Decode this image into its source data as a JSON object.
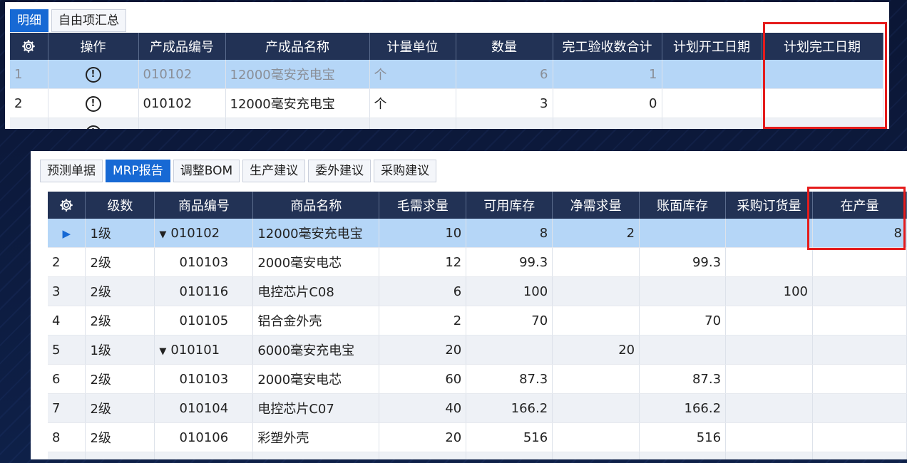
{
  "top_panel": {
    "tabs": [
      "明细",
      "自由项汇总"
    ],
    "headers": [
      "操作",
      "产成品编号",
      "产成品名称",
      "计量单位",
      "数量",
      "完工验收数合计",
      "计划开工日期",
      "计划完工日期"
    ],
    "rows": [
      {
        "idx": "1",
        "code": "010102",
        "name": "12000毫安充电宝",
        "unit": "个",
        "qty": "6",
        "done": "1",
        "start": "",
        "end": ""
      },
      {
        "idx": "2",
        "code": "010102",
        "name": "12000毫安充电宝",
        "unit": "个",
        "qty": "3",
        "done": "0",
        "start": "",
        "end": ""
      }
    ]
  },
  "bottom_panel": {
    "tabs": [
      "预测单据",
      "MRP报告",
      "调整BOM",
      "生产建议",
      "委外建议",
      "采购建议"
    ],
    "headers": [
      "级数",
      "商品编号",
      "商品名称",
      "毛需求量",
      "可用库存",
      "净需求量",
      "账面库存",
      "采购订货量",
      "在产量"
    ],
    "rows": [
      {
        "idx": "",
        "level": "1级",
        "code": "010102",
        "name": "12000毫安充电宝",
        "gross": "10",
        "avail": "8",
        "net": "2",
        "book": "",
        "purch": "",
        "wip": "8"
      },
      {
        "idx": "2",
        "level": "2级",
        "code": "010103",
        "name": "2000毫安电芯",
        "gross": "12",
        "avail": "99.3",
        "net": "",
        "book": "99.3",
        "purch": "",
        "wip": ""
      },
      {
        "idx": "3",
        "level": "2级",
        "code": "010116",
        "name": "电控芯片C08",
        "gross": "6",
        "avail": "100",
        "net": "",
        "book": "",
        "purch": "100",
        "wip": ""
      },
      {
        "idx": "4",
        "level": "2级",
        "code": "010105",
        "name": "铝合金外壳",
        "gross": "2",
        "avail": "70",
        "net": "",
        "book": "70",
        "purch": "",
        "wip": ""
      },
      {
        "idx": "5",
        "level": "1级",
        "code": "010101",
        "name": "6000毫安充电宝",
        "gross": "20",
        "avail": "",
        "net": "20",
        "book": "",
        "purch": "",
        "wip": ""
      },
      {
        "idx": "6",
        "level": "2级",
        "code": "010103",
        "name": "2000毫安电芯",
        "gross": "60",
        "avail": "87.3",
        "net": "",
        "book": "87.3",
        "purch": "",
        "wip": ""
      },
      {
        "idx": "7",
        "level": "2级",
        "code": "010104",
        "name": "电控芯片C07",
        "gross": "40",
        "avail": "166.2",
        "net": "",
        "book": "166.2",
        "purch": "",
        "wip": ""
      },
      {
        "idx": "8",
        "level": "2级",
        "code": "010106",
        "name": "彩塑外壳",
        "gross": "20",
        "avail": "516",
        "net": "",
        "book": "516",
        "purch": "",
        "wip": ""
      }
    ]
  },
  "colors": {
    "header_bg": "#223255",
    "selected_row": "#b5d6f7",
    "active_tab": "#1769d4",
    "highlight": "#e51c1c"
  },
  "icons": {
    "settings": "gear-icon",
    "operation": "info-circle-icon",
    "current_row": "play-arrow-icon",
    "expand": "caret-down-icon"
  }
}
